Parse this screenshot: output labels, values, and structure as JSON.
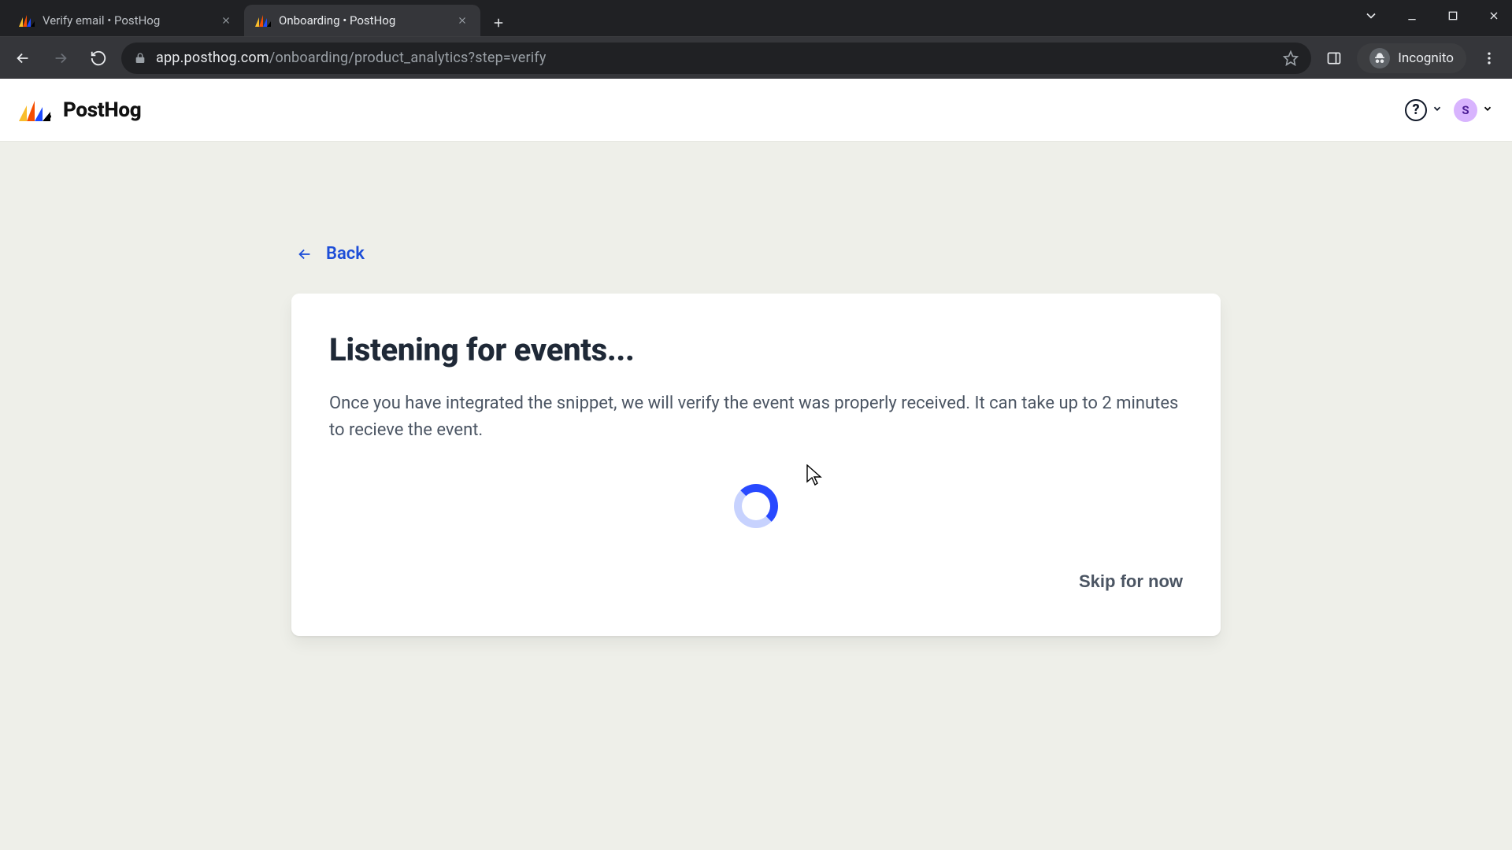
{
  "browser": {
    "tabs": [
      {
        "title": "Verify email • PostHog",
        "active": false
      },
      {
        "title": "Onboarding • PostHog",
        "active": true
      }
    ],
    "url_host": "app.posthog.com",
    "url_path": "/onboarding/product_analytics?step=verify",
    "incognito_label": "Incognito"
  },
  "header": {
    "brand": "PostHog",
    "help_symbol": "?",
    "avatar_initial": "S"
  },
  "content": {
    "back_label": "Back",
    "title": "Listening for events...",
    "description": "Once you have integrated the snippet, we will verify the event was properly received. It can take up to 2 minutes to recieve the event.",
    "skip_label": "Skip for now"
  }
}
